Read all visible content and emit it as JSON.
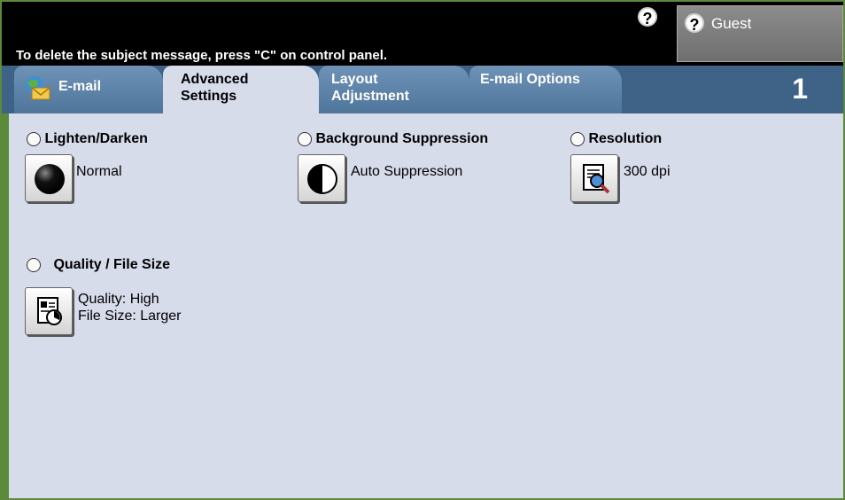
{
  "header": {
    "message": "To delete the subject message, press \"C\" on control panel.",
    "help_icon": "question-icon",
    "guest_label": "Guest"
  },
  "tabs": [
    {
      "label": "E-mail",
      "icon": "email-globe-icon",
      "active": false
    },
    {
      "label": "Advanced\nSettings",
      "active": true
    },
    {
      "label": "Layout\nAdjustment",
      "active": false
    },
    {
      "label": "E-mail Options",
      "active": false
    }
  ],
  "page_number": "1",
  "options": {
    "lighten_darken": {
      "title": "Lighten/Darken",
      "value": "Normal"
    },
    "background_suppression": {
      "title": "Background Suppression",
      "value": "Auto Suppression"
    },
    "resolution": {
      "title": "Resolution",
      "value": "300 dpi"
    },
    "quality_file_size": {
      "title": "Quality / File Size",
      "value_line1": "Quality: High",
      "value_line2": "File Size: Larger"
    }
  },
  "colors": {
    "frame": "#5d8a3a",
    "topbar": "#000000",
    "tab_active": "#d7dceb",
    "tab_inactive": "#5f85ab",
    "panel": "#d7dceb"
  }
}
